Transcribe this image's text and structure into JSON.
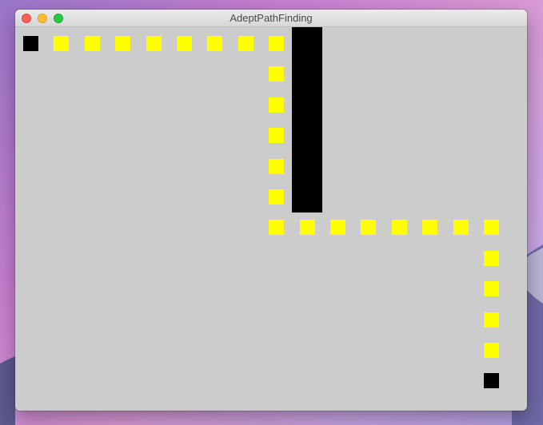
{
  "window": {
    "title": "AdeptPathFinding"
  },
  "colors": {
    "canvas": "#cccccc",
    "path": "#ffff00",
    "wall": "#000000",
    "start": "#000000",
    "goal": "#000000"
  },
  "grid": {
    "cols": 16,
    "rows": 12
  },
  "start": {
    "col": 0,
    "row": 0
  },
  "goal": {
    "col": 15,
    "row": 11
  },
  "walls": [
    {
      "col": 9,
      "row": 0
    },
    {
      "col": 9,
      "row": 1
    },
    {
      "col": 9,
      "row": 2
    },
    {
      "col": 9,
      "row": 3
    },
    {
      "col": 9,
      "row": 4
    },
    {
      "col": 9,
      "row": 5
    }
  ],
  "path": [
    {
      "col": 1,
      "row": 0
    },
    {
      "col": 2,
      "row": 0
    },
    {
      "col": 3,
      "row": 0
    },
    {
      "col": 4,
      "row": 0
    },
    {
      "col": 5,
      "row": 0
    },
    {
      "col": 6,
      "row": 0
    },
    {
      "col": 7,
      "row": 0
    },
    {
      "col": 8,
      "row": 0
    },
    {
      "col": 8,
      "row": 1
    },
    {
      "col": 8,
      "row": 2
    },
    {
      "col": 8,
      "row": 3
    },
    {
      "col": 8,
      "row": 4
    },
    {
      "col": 8,
      "row": 5
    },
    {
      "col": 8,
      "row": 6
    },
    {
      "col": 9,
      "row": 6
    },
    {
      "col": 10,
      "row": 6
    },
    {
      "col": 11,
      "row": 6
    },
    {
      "col": 12,
      "row": 6
    },
    {
      "col": 13,
      "row": 6
    },
    {
      "col": 14,
      "row": 6
    },
    {
      "col": 15,
      "row": 6
    },
    {
      "col": 15,
      "row": 7
    },
    {
      "col": 15,
      "row": 8
    },
    {
      "col": 15,
      "row": 9
    },
    {
      "col": 15,
      "row": 10
    }
  ]
}
